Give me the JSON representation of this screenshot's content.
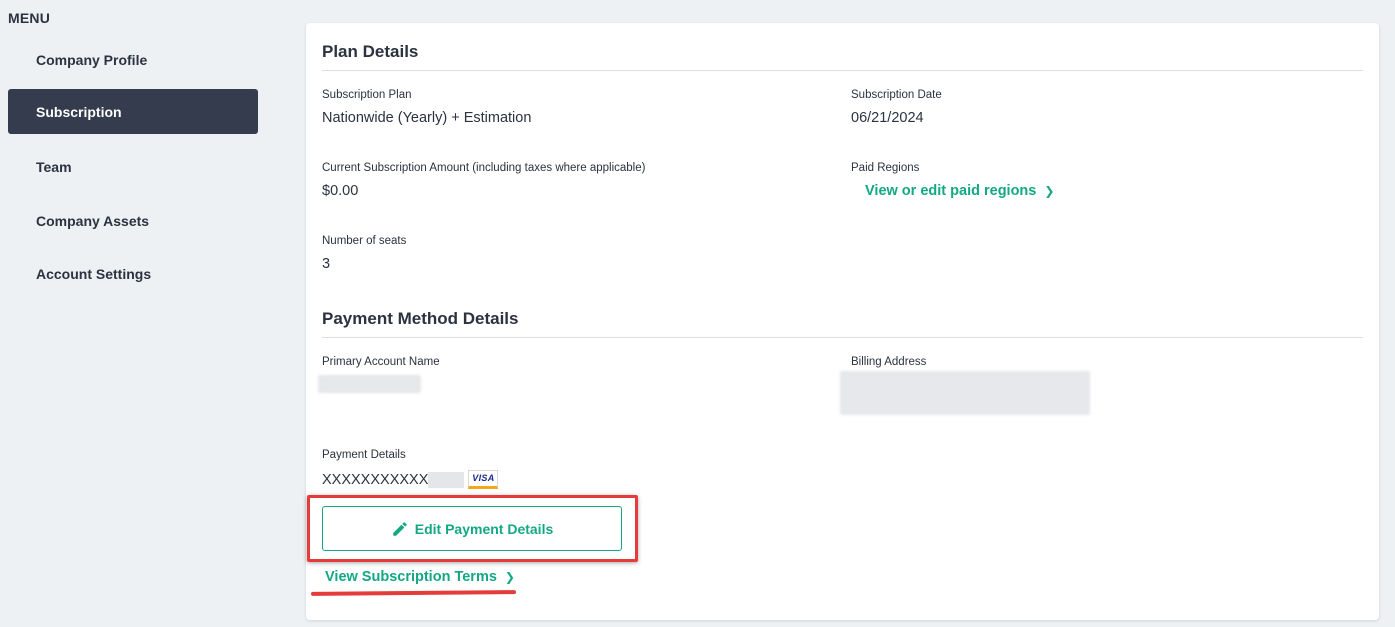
{
  "sidebar": {
    "title": "MENU",
    "items": [
      {
        "label": "Company Profile",
        "active": false
      },
      {
        "label": "Subscription",
        "active": true
      },
      {
        "label": "Team",
        "active": false
      },
      {
        "label": "Company Assets",
        "active": false
      },
      {
        "label": "Account Settings",
        "active": false
      }
    ]
  },
  "plan": {
    "title": "Plan Details",
    "subscription_plan_label": "Subscription Plan",
    "subscription_plan_value": "Nationwide (Yearly) + Estimation",
    "subscription_date_label": "Subscription Date",
    "subscription_date_value": "06/21/2024",
    "amount_label": "Current Subscription Amount (including taxes where applicable)",
    "amount_value": "$0.00",
    "paid_regions_label": "Paid Regions",
    "paid_regions_link": "View or edit paid regions",
    "seats_label": "Number of seats",
    "seats_value": "3"
  },
  "payment": {
    "title": "Payment Method Details",
    "primary_account_label": "Primary Account Name",
    "billing_address_label": "Billing Address",
    "payment_details_label": "Payment Details",
    "card_number_masked": "XXXXXXXXXXX",
    "card_brand": "VISA",
    "edit_button_label": "Edit Payment Details",
    "terms_link": "View Subscription Terms"
  },
  "colors": {
    "accent_green": "#13a884",
    "sidebar_active": "#343c4e",
    "annotation_red": "#e53b3b"
  },
  "icons": {
    "edit": "pencil-icon",
    "link_chevron": "chevron-right-icon"
  }
}
